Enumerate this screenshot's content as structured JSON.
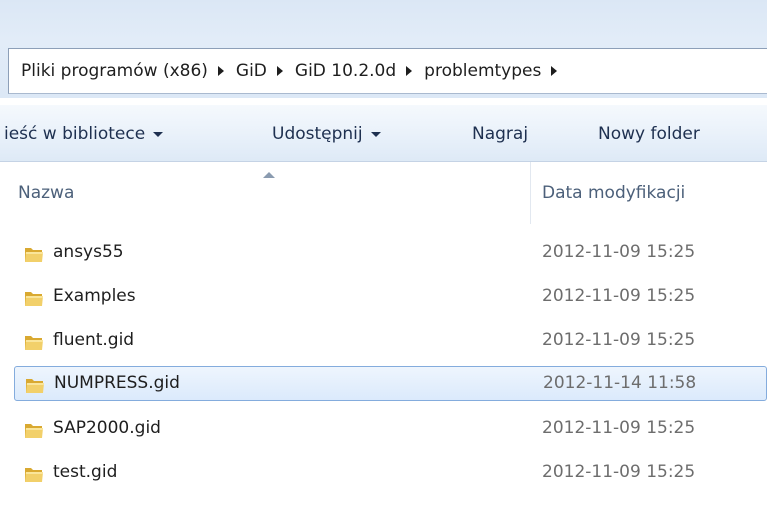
{
  "address_bar": {
    "crumbs": [
      "Pliki programów (x86)",
      "GiD",
      "GiD 10.2.0d",
      "problemtypes"
    ]
  },
  "command_bar": {
    "items": [
      {
        "label": "ieść w bibliotece",
        "dropdown": true
      },
      {
        "label": "Udostępnij",
        "dropdown": true
      },
      {
        "label": "Nagraj",
        "dropdown": false
      },
      {
        "label": "Nowy folder",
        "dropdown": false
      }
    ]
  },
  "columns": {
    "name": "Nazwa",
    "date": "Data modyfikacji",
    "sorted_by": "name",
    "sort_icon": "sort-ascending-icon"
  },
  "files": [
    {
      "name": "ansys55",
      "date": "2012-11-09 15:25",
      "icon": "folder-icon",
      "selected": false
    },
    {
      "name": "Examples",
      "date": "2012-11-09 15:25",
      "icon": "folder-icon",
      "selected": false
    },
    {
      "name": "fluent.gid",
      "date": "2012-11-09 15:25",
      "icon": "folder-icon",
      "selected": false
    },
    {
      "name": "NUMPRESS.gid",
      "date": "2012-11-14 11:58",
      "icon": "folder-icon",
      "selected": true
    },
    {
      "name": "SAP2000.gid",
      "date": "2012-11-09 15:25",
      "icon": "folder-icon",
      "selected": false
    },
    {
      "name": "test.gid",
      "date": "2012-11-09 15:25",
      "icon": "folder-icon",
      "selected": false
    }
  ],
  "colors": {
    "selection_fill": "#dbeafc",
    "selection_border": "#84acdd",
    "folder_yellow": "#e8c25a"
  }
}
